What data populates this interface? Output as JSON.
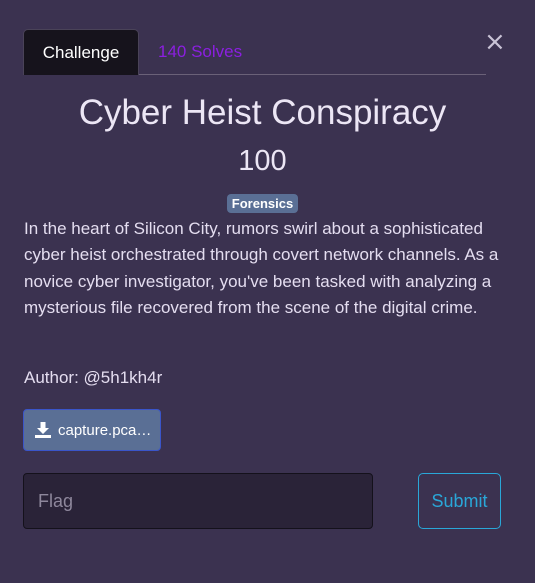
{
  "modal": {
    "close_icon": "close-icon",
    "close_glyph": "×"
  },
  "tabs": [
    {
      "label": "Challenge",
      "active": true
    },
    {
      "label": "140 Solves",
      "active": false
    }
  ],
  "challenge": {
    "title": "Cyber Heist Conspiracy",
    "points": "100",
    "category": "Forensics",
    "description": "In the heart of Silicon City, rumors swirl about a sophisticated cyber heist orchestrated through covert network channels. As a novice cyber investigator, you've been tasked with analyzing a mysterious file recovered from the scene of the digital crime.",
    "author": "Author: @5h1kh4r"
  },
  "file": {
    "icon": "download-icon",
    "label": "capture.pca…"
  },
  "submission": {
    "placeholder": "Flag",
    "value": "",
    "submit_label": "Submit"
  },
  "colors": {
    "background": "#3b3250",
    "solves_tab": "#8b1fe0",
    "badge": "#5a6f95",
    "submit": "#2aa7d8"
  }
}
